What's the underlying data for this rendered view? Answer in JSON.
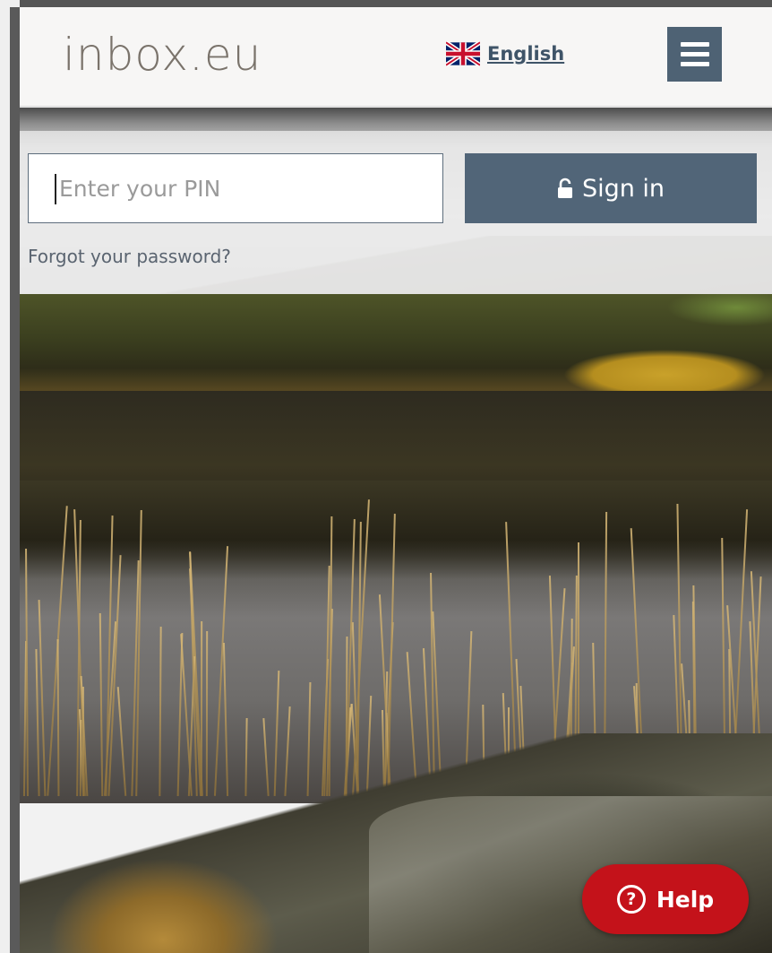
{
  "header": {
    "logo_text": "inbox.eu",
    "language": {
      "label": "English",
      "flag_icon": "uk-flag-icon"
    },
    "menu_icon": "hamburger-menu-icon"
  },
  "login": {
    "pin_placeholder": "Enter your PIN",
    "pin_value": "",
    "signin_label": "Sign in",
    "signin_icon": "lock-icon",
    "forgot_label": "Forgot your password?"
  },
  "help": {
    "icon": "question-circle-icon",
    "icon_glyph": "?",
    "label": "Help"
  },
  "colors": {
    "accent": "#516578",
    "help_red": "#c4121a",
    "logo_gray": "#7a736b"
  }
}
